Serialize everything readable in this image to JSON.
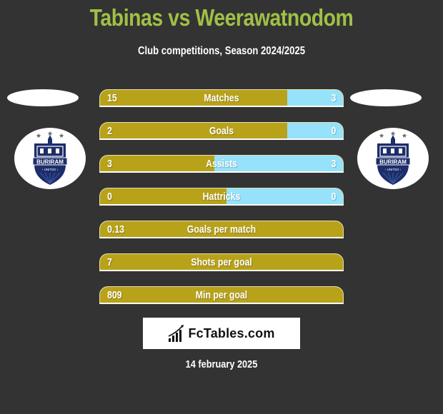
{
  "header": {
    "title": "Tabinas vs Weerawatnodom",
    "subtitle": "Club competitions, Season 2024/2025"
  },
  "players": {
    "left": {
      "name": "Tabinas",
      "club_logo": "buriram-united-logo"
    },
    "right": {
      "name": "Weerawatnodom",
      "club_logo": "buriram-united-logo"
    }
  },
  "colors": {
    "left_bar": "#b8a21a",
    "right_bar": "#95e2fa",
    "title": "#a0c046",
    "background": "#333333"
  },
  "stats": [
    {
      "label": "Matches",
      "left": "15",
      "right": "3",
      "left_share": 0.77
    },
    {
      "label": "Goals",
      "left": "2",
      "right": "0",
      "left_share": 0.77
    },
    {
      "label": "Assists",
      "left": "3",
      "right": "3",
      "left_share": 0.47
    },
    {
      "label": "Hattricks",
      "left": "0",
      "right": "0",
      "left_share": 0.52
    },
    {
      "label": "Goals per match",
      "left": "0.13",
      "right": null,
      "left_share": 1.0
    },
    {
      "label": "Shots per goal",
      "left": "7",
      "right": null,
      "left_share": 1.0
    },
    {
      "label": "Min per goal",
      "left": "809",
      "right": null,
      "left_share": 1.0
    }
  ],
  "brand": {
    "name": "FcTables.com",
    "icon": "bar-chart-icon"
  },
  "date": "14 february 2025"
}
